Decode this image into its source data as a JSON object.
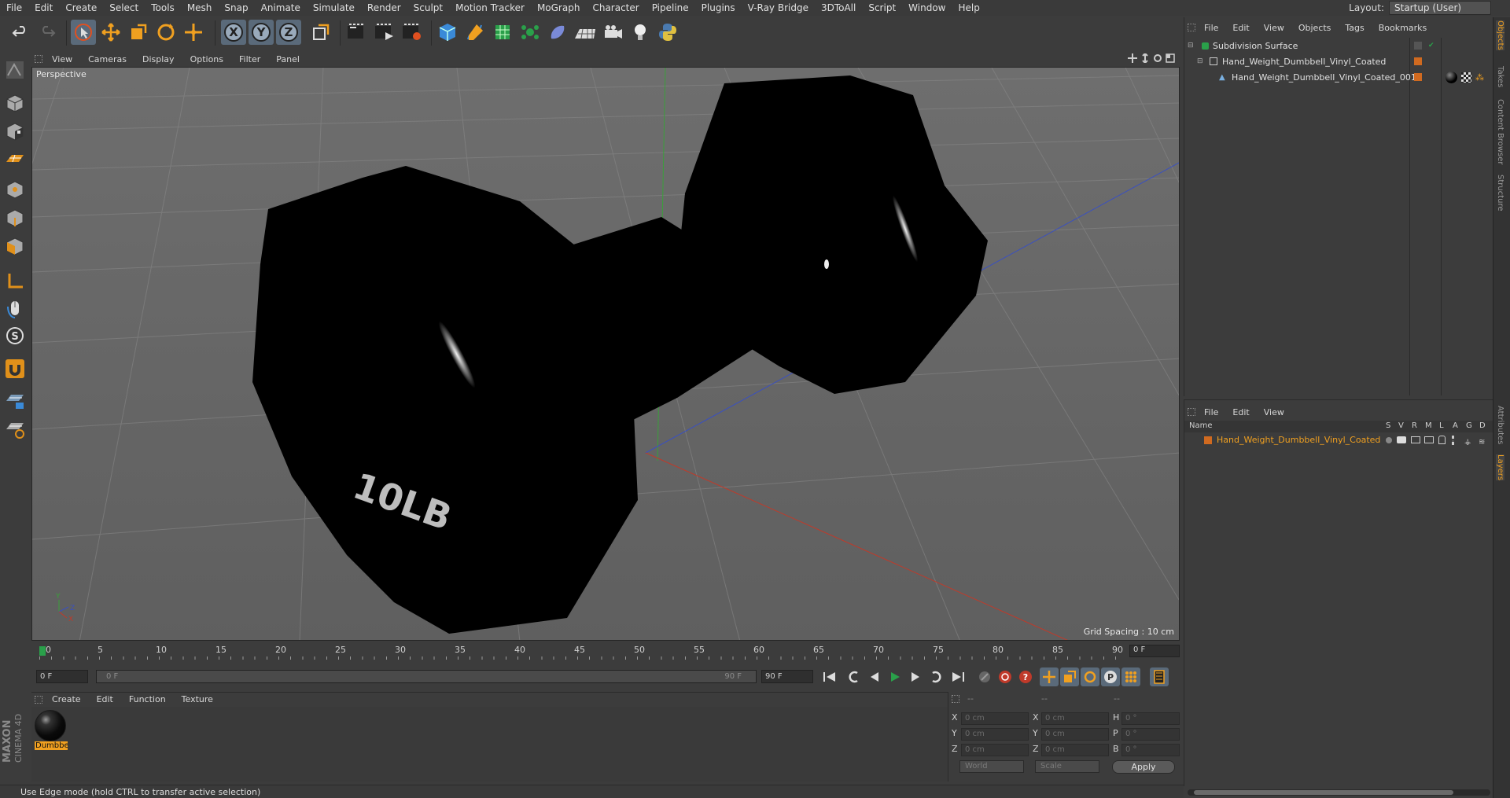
{
  "menubar": {
    "items": [
      "File",
      "Edit",
      "Create",
      "Select",
      "Tools",
      "Mesh",
      "Snap",
      "Animate",
      "Simulate",
      "Render",
      "Sculpt",
      "Motion Tracker",
      "MoGraph",
      "Character",
      "Pipeline",
      "Plugins",
      "V-Ray Bridge",
      "3DToAll",
      "Script",
      "Window",
      "Help"
    ],
    "layout_label": "Layout:",
    "layout_value": "Startup (User)"
  },
  "viewport": {
    "menu": [
      "View",
      "Cameras",
      "Display",
      "Options",
      "Filter",
      "Panel"
    ],
    "label": "Perspective",
    "grid_spacing": "Grid Spacing : 10 cm",
    "model_text": "10LB",
    "axis_labels": {
      "y": "Y",
      "z": "Z",
      "x": "X"
    }
  },
  "timeline": {
    "ticks": [
      "0",
      "5",
      "10",
      "15",
      "20",
      "25",
      "30",
      "35",
      "40",
      "45",
      "50",
      "55",
      "60",
      "65",
      "70",
      "75",
      "80",
      "85",
      "90"
    ],
    "frame_field": "0 F"
  },
  "playback": {
    "start": "0 F",
    "range_start": "0 F",
    "range_end": "90 F",
    "end": "90 F"
  },
  "materials": {
    "menu": [
      "Create",
      "Edit",
      "Function",
      "Texture"
    ],
    "items": [
      {
        "name": "Dumbbe"
      }
    ]
  },
  "coords": {
    "headers": [
      "--",
      "--",
      "--"
    ],
    "rows": [
      {
        "l1": "X",
        "v1": "0 cm",
        "l2": "X",
        "v2": "0 cm",
        "l3": "H",
        "v3": "0 °"
      },
      {
        "l1": "Y",
        "v1": "0 cm",
        "l2": "Y",
        "v2": "0 cm",
        "l3": "P",
        "v3": "0 °"
      },
      {
        "l1": "Z",
        "v1": "0 cm",
        "l2": "Z",
        "v2": "0 cm",
        "l3": "B",
        "v3": "0 °"
      }
    ],
    "world": "World",
    "scale": "Scale",
    "apply": "Apply"
  },
  "status": "Use Edge mode (hold CTRL to transfer active selection)",
  "object_manager": {
    "menu": [
      "File",
      "Edit",
      "View",
      "Objects",
      "Tags",
      "Bookmarks"
    ],
    "objects": [
      {
        "name": "Subdivision Surface"
      },
      {
        "name": "Hand_Weight_Dumbbell_Vinyl_Coated"
      },
      {
        "name": "Hand_Weight_Dumbbell_Vinyl_Coated_001"
      }
    ]
  },
  "layers": {
    "menu": [
      "File",
      "Edit",
      "View"
    ],
    "col_name": "Name",
    "cols": [
      "S",
      "V",
      "R",
      "M",
      "L",
      "A",
      "G",
      "D"
    ],
    "row": "Hand_Weight_Dumbbell_Vinyl_Coated"
  },
  "right_tabs": [
    "Objects",
    "Takes",
    "Content Browser",
    "Structure",
    "Attributes",
    "Layers"
  ],
  "maxon": {
    "line1": "MAXON",
    "line2": "CINEMA 4D"
  },
  "colors": {
    "accent": "#f0a020",
    "object_dot": "#d06a20",
    "x_axis": "#c03a2a",
    "y_axis": "#3aa03a",
    "z_axis": "#3a50c0"
  }
}
